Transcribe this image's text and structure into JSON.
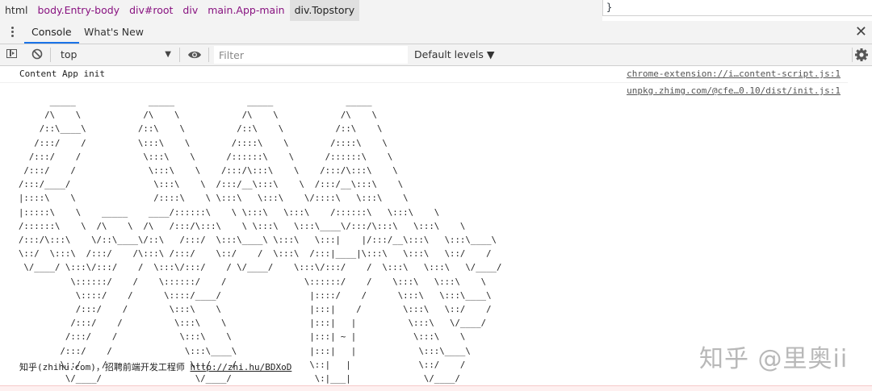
{
  "breadcrumbs": [
    "html",
    "body.Entry-body",
    "div#root",
    "div",
    "main.App-main",
    "div.Topstory"
  ],
  "styles_pane_text": "}",
  "drawer": {
    "tabs": [
      "Console",
      "What's New"
    ],
    "active_tab": "Console",
    "close_icon": "close-icon"
  },
  "toolbar": {
    "context": "top",
    "filter_placeholder": "Filter",
    "levels": "Default levels ▼",
    "icons": [
      "sidebar-icon",
      "clear-console-icon",
      "eye-icon",
      "gear-icon"
    ]
  },
  "console": {
    "message1": {
      "text": "Content App init",
      "source": "chrome-extension://i…content-script.js:1"
    },
    "message2": {
      "source": "unpkg.zhimg.com/@cfe…0.10/dist/init.js:1",
      "ascii_art": "      _____              _____              _____              _____\n     /\\    \\            /\\    \\            /\\    \\            /\\    \\\n    /::\\____\\          /::\\    \\          /::\\    \\          /::\\    \\\n   /:::/    /          \\:::\\    \\        /::::\\    \\        /::::\\    \\\n  /:::/    /            \\:::\\    \\      /::::::\\    \\      /::::::\\    \\\n /:::/    /              \\:::\\    \\    /:::/\\:::\\    \\    /:::/\\:::\\    \\\n/:::/____/                \\:::\\    \\  /:::/__\\:::\\    \\  /:::/__\\:::\\    \\\n|::::\\    \\               /::::\\    \\ \\:::\\   \\:::\\    \\/::::\\   \\:::\\    \\\n|:::::\\    \\    _____    ____/::::::\\    \\ \\:::\\   \\:::\\    /::::::\\   \\:::\\    \\\n/::::::\\    \\  /\\    \\  /\\   /:::/\\:::\\    \\ \\:::\\   \\:::\\____\\/:::/\\:::\\   \\:::\\    \\\n/:::/\\:::\\    \\/::\\____\\/::\\   /:::/  \\:::\\____\\ \\:::\\   \\:::|    |/:::/__\\:::\\   \\:::\\____\\\n\\::/  \\:::\\  /:::/    /\\:::\\ /:::/    \\::/    /  \\:::\\  /:::|____|\\:::\\   \\:::\\   \\::/    /\n \\/____/ \\:::\\/:::/    /  \\:::\\/:::/    / \\/____/    \\:::\\/:::/    /  \\:::\\   \\:::\\   \\/____/\n          \\::::::/    /    \\::::::/    /               \\::::::/    /    \\:::\\   \\:::\\    \\\n           \\::::/    /      \\::::/____/                 |::::/    /      \\:::\\   \\:::\\____\\\n           /:::/    /        \\:::\\    \\                 |:::|    /        \\:::\\   \\::/    /\n          /:::/    /          \\:::\\    \\                |:::|   |          \\:::\\   \\/____/\n         /:::/    /            \\:::\\    \\               |:::| ~ |           \\:::\\    \\\n        /:::/    /              \\:::\\____\\              |:::|   |            \\:::\\____\\\n        \\::/    /                \\::/    /              \\::|   |             \\::/    /\n         \\/____/                  \\/____/                \\:|___|              \\/____/",
      "footer_text": "知乎(zhihu.com)，招聘前端开发工程师 ",
      "footer_link": "http://zhi.hu/BDXoD"
    }
  },
  "watermark": "知乎 @里奥ii"
}
